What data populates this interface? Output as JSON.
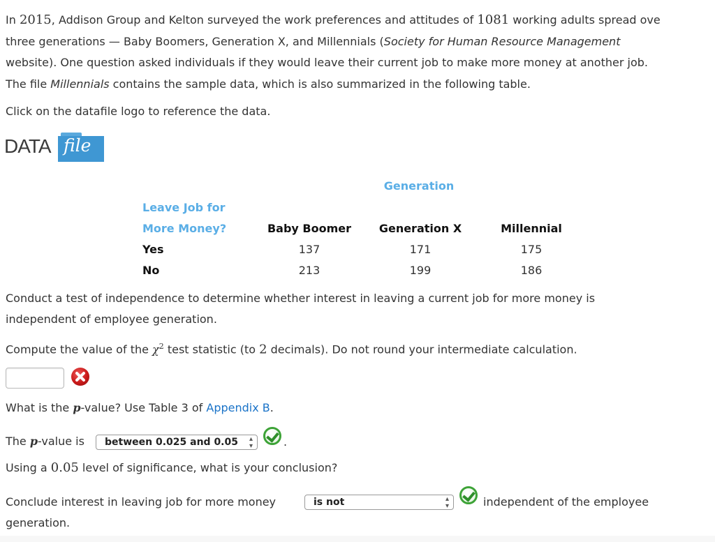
{
  "intro": {
    "l1_a": "In ",
    "year": "2015",
    "l1_b": ", Addison Group and Kelton surveyed the work preferences and attitudes of ",
    "count": "1081",
    "l1_c": " working adults spread ove",
    "l2_a": "three generations — Baby Boomers, Generation X, and Millennials (",
    "l2_it": "Society for Human Resource Management",
    "l3": "website). One question asked individuals if they would leave their current job to make more money at another job.",
    "l4_a": "The file ",
    "l4_it": "Millennials",
    "l4_b": " contains the sample data, which is also summarized in the following table."
  },
  "datafile": {
    "instruction": "Click on the datafile logo to reference the data.",
    "logo_word1": "DATA",
    "logo_word2": "file"
  },
  "table": {
    "column_group": "Generation",
    "row_header_l1": "Leave Job for",
    "row_header_l2": "More Money?",
    "columns": [
      "Baby Boomer",
      "Generation X",
      "Millennial"
    ],
    "rows": [
      {
        "label": "Yes",
        "values": [
          "137",
          "171",
          "175"
        ]
      },
      {
        "label": "No",
        "values": [
          "213",
          "199",
          "186"
        ]
      }
    ]
  },
  "question": {
    "p1_l1": "Conduct a test of independence to determine whether interest in leaving a current job for more money is",
    "p1_l2": "independent of employee generation.",
    "p2_a": "Compute the value of the ",
    "chi": "χ",
    "chi_sup": "2",
    "p2_b": " test statistic (to ",
    "decimals": "2",
    "p2_c": " decimals). Do not round your intermediate calculation."
  },
  "answer1": {
    "value": "",
    "status": "incorrect"
  },
  "pvalue": {
    "q_a": "What is the ",
    "p": "p",
    "q_b": "-value? Use Table 3 of ",
    "link": "Appendix B",
    "q_c": ".",
    "s_a": "The ",
    "s_b": "-value is",
    "selected": "between 0.025 and 0.05",
    "status": "correct",
    "s_end": "."
  },
  "conclusion": {
    "q_a": "Using a ",
    "alpha": "0.05",
    "q_b": " level of significance, what is your conclusion?",
    "s_a": "Conclude interest in leaving job for more money",
    "selected": "is not",
    "status": "correct",
    "s_b": "independent of the employee",
    "s_c": "generation."
  }
}
